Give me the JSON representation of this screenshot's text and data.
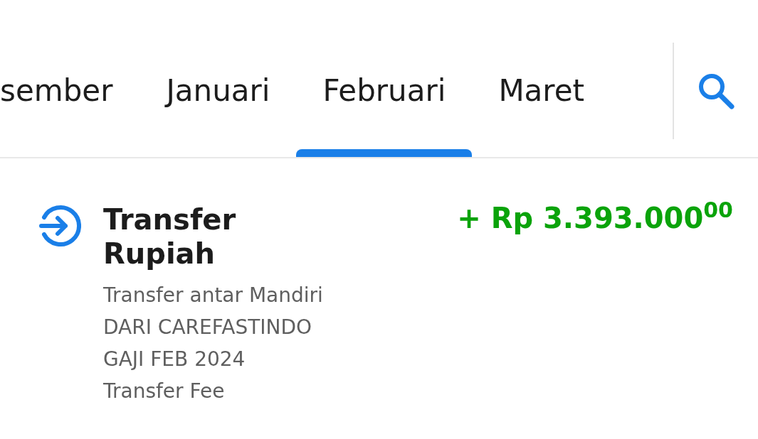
{
  "tabs": [
    {
      "label": "sember",
      "selected": false
    },
    {
      "label": "Januari",
      "selected": false
    },
    {
      "label": "Februari",
      "selected": true
    },
    {
      "label": "Maret",
      "selected": false
    }
  ],
  "transactions": [
    {
      "title": "Transfer Rupiah",
      "amount": "+ Rp 3.393.000$^{00}$",
      "kind": "incoming",
      "details": [
        "Transfer antar Mandiri",
        "DARI CAREFASTINDO",
        "GAJI FEB 2024",
        "Transfer Fee"
      ]
    }
  ]
}
